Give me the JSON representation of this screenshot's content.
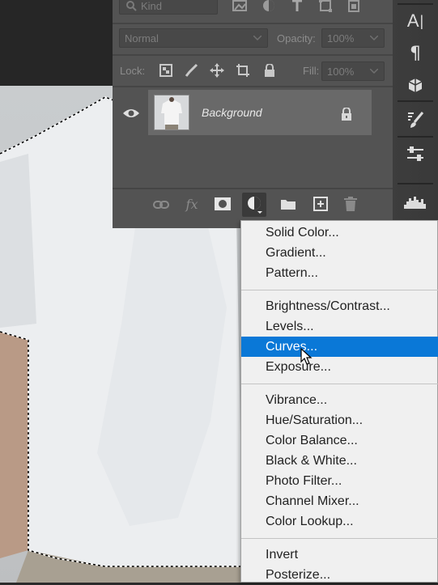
{
  "layers_panel": {
    "filter_kind": "Kind",
    "blend_mode": "Normal",
    "opacity_label": "Opacity:",
    "opacity_value": "100%",
    "lock_label": "Lock:",
    "fill_label": "Fill:",
    "fill_value": "100%",
    "layer": {
      "name": "Background",
      "visible": true,
      "locked": true
    },
    "footer_icons": [
      "link-icon",
      "fx-icon",
      "mask-icon",
      "adjustment-icon",
      "folder-icon",
      "new-layer-icon",
      "trash-icon"
    ]
  },
  "right_toolbar": {
    "icons": [
      "character-icon",
      "paragraph-icon",
      "3d-icon",
      "brush-settings-icon",
      "adjustments-icon",
      "histogram-icon"
    ]
  },
  "adjustment_menu": {
    "groups": [
      [
        "Solid Color...",
        "Gradient...",
        "Pattern..."
      ],
      [
        "Brightness/Contrast...",
        "Levels...",
        "Curves...",
        "Exposure..."
      ],
      [
        "Vibrance...",
        "Hue/Saturation...",
        "Color Balance...",
        "Black & White...",
        "Photo Filter...",
        "Channel Mixer...",
        "Color Lookup..."
      ],
      [
        "Invert",
        "Posterize..."
      ]
    ],
    "highlighted": "Curves...",
    "highlight_color": "#0a78d7"
  }
}
